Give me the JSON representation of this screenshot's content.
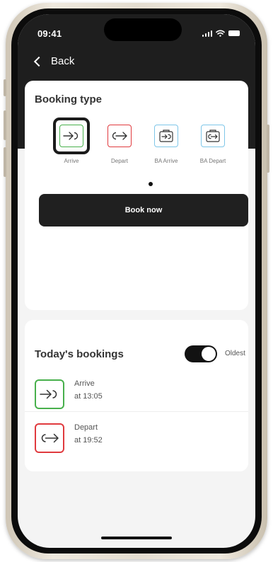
{
  "status_bar": {
    "time": "09:41"
  },
  "nav": {
    "back_label": "Back"
  },
  "booking_type": {
    "title": "Booking type",
    "types": [
      {
        "label": "Arrive",
        "icon": "arrive-icon",
        "color": "#48b04c",
        "selected": true
      },
      {
        "label": "Depart",
        "icon": "depart-icon",
        "color": "#e03a3e",
        "selected": false
      },
      {
        "label": "BA Arrive",
        "icon": "ba-arrive-icon",
        "color": "#7ec6e8",
        "selected": false
      },
      {
        "label": "BA Depart",
        "icon": "ba-depart-icon",
        "color": "#7ec6e8",
        "selected": false
      }
    ],
    "book_button_label": "Book now"
  },
  "todays_bookings": {
    "title": "Today's bookings",
    "sort_toggle": {
      "label": "Oldest",
      "on": true
    },
    "items": [
      {
        "title": "Arrive",
        "time": "at 13:05",
        "icon": "arrive-icon",
        "color": "#48b04c"
      },
      {
        "title": "Depart",
        "time": "at 19:52",
        "icon": "depart-icon",
        "color": "#e03a3e"
      }
    ]
  },
  "colors": {
    "header_bg": "#1e1e1e",
    "arrive": "#48b04c",
    "depart": "#e03a3e",
    "ba": "#7ec6e8"
  }
}
